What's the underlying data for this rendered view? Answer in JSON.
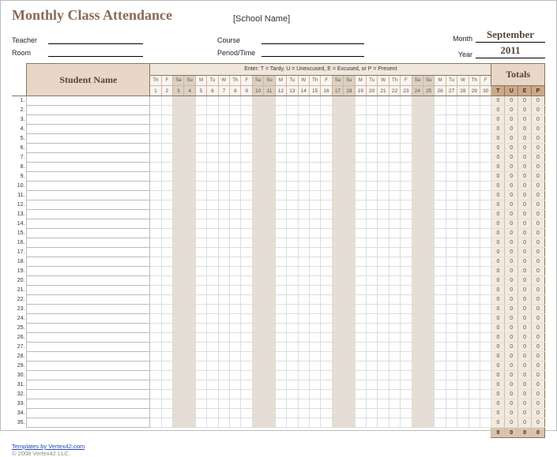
{
  "title": "Monthly Class Attendance",
  "school_placeholder": "[School Name]",
  "fields": {
    "teacher_label": "Teacher",
    "room_label": "Room",
    "course_label": "Course",
    "period_label": "Period/Time",
    "month_label": "Month",
    "year_label": "Year"
  },
  "month_value": "September",
  "year_value": "2011",
  "legend_text": "Enter:  T = Tardy,  U = Unexcused,  E = Excused,  or P = Present",
  "name_header": "Student Name",
  "totals_header": "Totals",
  "total_codes": [
    "T",
    "U",
    "E",
    "P"
  ],
  "days": [
    {
      "n": 1,
      "dow": "Th",
      "wk": false
    },
    {
      "n": 2,
      "dow": "F",
      "wk": false
    },
    {
      "n": 3,
      "dow": "Sa",
      "wk": true
    },
    {
      "n": 4,
      "dow": "Su",
      "wk": true
    },
    {
      "n": 5,
      "dow": "M",
      "wk": false
    },
    {
      "n": 6,
      "dow": "Tu",
      "wk": false
    },
    {
      "n": 7,
      "dow": "W",
      "wk": false
    },
    {
      "n": 8,
      "dow": "Th",
      "wk": false
    },
    {
      "n": 9,
      "dow": "F",
      "wk": false
    },
    {
      "n": 10,
      "dow": "Sa",
      "wk": true
    },
    {
      "n": 11,
      "dow": "Su",
      "wk": true
    },
    {
      "n": 12,
      "dow": "M",
      "wk": false
    },
    {
      "n": 13,
      "dow": "Tu",
      "wk": false
    },
    {
      "n": 14,
      "dow": "W",
      "wk": false
    },
    {
      "n": 15,
      "dow": "Th",
      "wk": false
    },
    {
      "n": 16,
      "dow": "F",
      "wk": false
    },
    {
      "n": 17,
      "dow": "Sa",
      "wk": true
    },
    {
      "n": 18,
      "dow": "Su",
      "wk": true
    },
    {
      "n": 19,
      "dow": "M",
      "wk": false
    },
    {
      "n": 20,
      "dow": "Tu",
      "wk": false
    },
    {
      "n": 21,
      "dow": "W",
      "wk": false
    },
    {
      "n": 22,
      "dow": "Th",
      "wk": false
    },
    {
      "n": 23,
      "dow": "F",
      "wk": false
    },
    {
      "n": 24,
      "dow": "Sa",
      "wk": true
    },
    {
      "n": 25,
      "dow": "Su",
      "wk": true
    },
    {
      "n": 26,
      "dow": "M",
      "wk": false
    },
    {
      "n": 27,
      "dow": "Tu",
      "wk": false
    },
    {
      "n": 28,
      "dow": "W",
      "wk": false
    },
    {
      "n": 29,
      "dow": "Th",
      "wk": false
    },
    {
      "n": 30,
      "dow": "F",
      "wk": false
    }
  ],
  "row_count": 35,
  "row_totals_default": [
    0,
    0,
    0,
    0
  ],
  "grand_totals": [
    0,
    0,
    0,
    0
  ],
  "footer": {
    "link_text": "Templates by Vertex42.com",
    "copyright": "© 2008 Vertex42 LLC."
  }
}
